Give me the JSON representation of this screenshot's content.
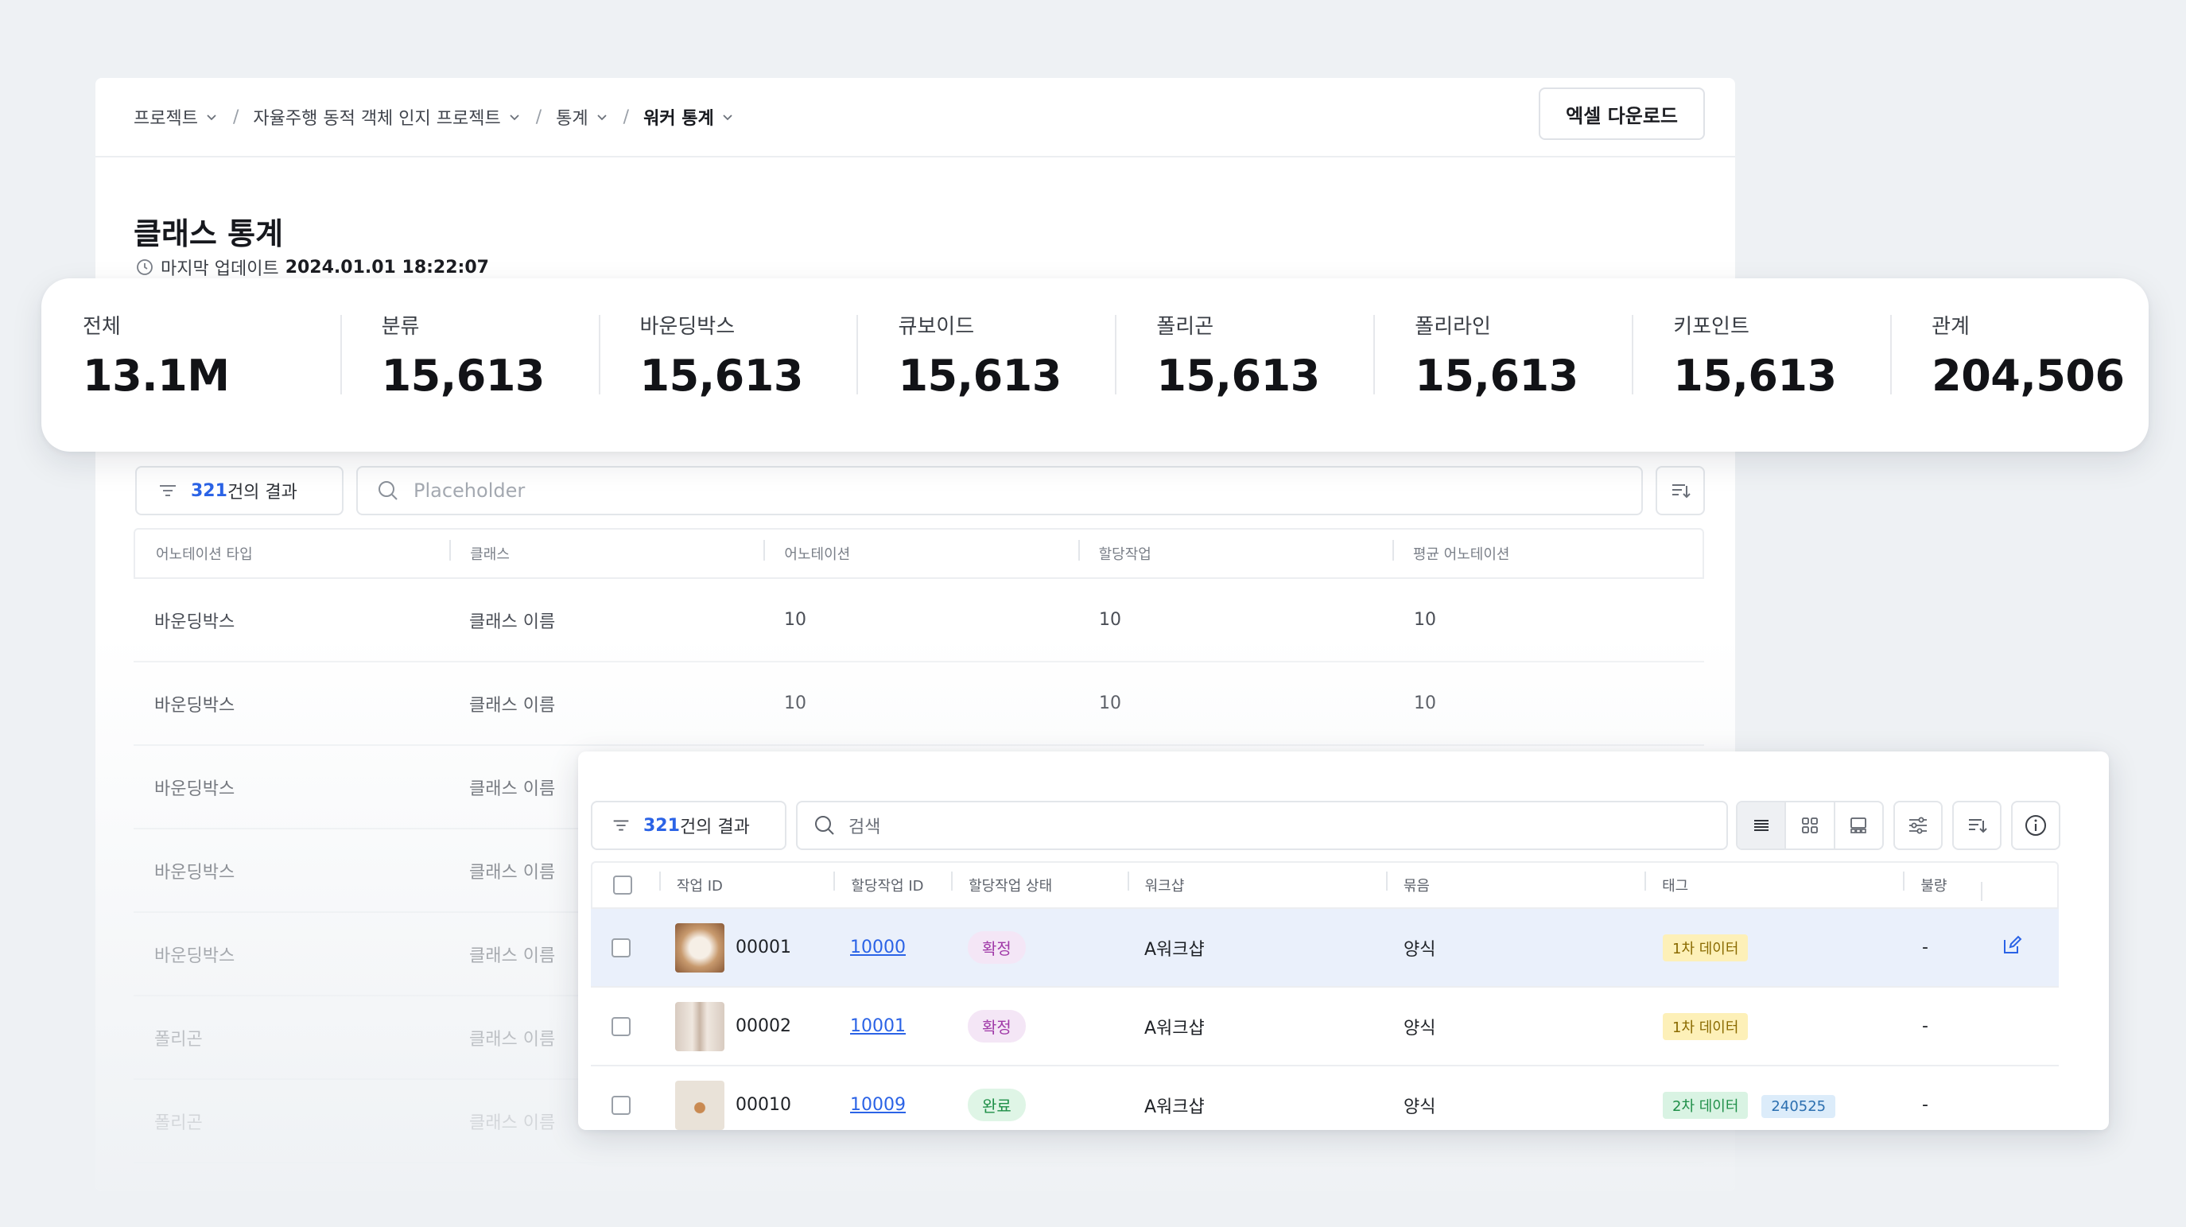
{
  "breadcrumb": [
    "프로젝트",
    "자율주행 동적 객체 인지 프로젝트",
    "통계",
    "워커 통계"
  ],
  "header": {
    "excel_download": "엑셀 다운로드"
  },
  "page": {
    "title": "클래스 통계",
    "last_update_label": "마지막 업데이트",
    "last_update_value": "2024.01.01 18:22:07"
  },
  "stats": [
    {
      "label": "전체",
      "value": "13.1M"
    },
    {
      "label": "분류",
      "value": "15,613"
    },
    {
      "label": "바운딩박스",
      "value": "15,613"
    },
    {
      "label": "큐보이드",
      "value": "15,613"
    },
    {
      "label": "폴리곤",
      "value": "15,613"
    },
    {
      "label": "폴리라인",
      "value": "15,613"
    },
    {
      "label": "키포인트",
      "value": "15,613"
    },
    {
      "label": "관계",
      "value": "204,506"
    }
  ],
  "class_table": {
    "result_count": "321",
    "result_suffix": "건의 결과",
    "search_placeholder": "Placeholder",
    "columns": [
      "어노테이션 타입",
      "클래스",
      "어노테이션",
      "할당작업",
      "평균 어노테이션"
    ],
    "rows": [
      [
        "바운딩박스",
        "클래스 이름",
        "10",
        "10",
        "10"
      ],
      [
        "바운딩박스",
        "클래스 이름",
        "10",
        "10",
        "10"
      ],
      [
        "바운딩박스",
        "클래스 이름",
        "",
        "",
        ""
      ],
      [
        "바운딩박스",
        "클래스 이름",
        "",
        "",
        ""
      ],
      [
        "바운딩박스",
        "클래스 이름",
        "",
        "",
        ""
      ],
      [
        "폴리곤",
        "클래스 이름",
        "",
        "",
        ""
      ],
      [
        "폴리곤",
        "클래스 이름",
        "",
        "",
        ""
      ]
    ]
  },
  "task_table": {
    "result_count": "321",
    "result_suffix": "건의 결과",
    "search_placeholder": "검색",
    "columns": [
      "작업 ID",
      "할당작업 ID",
      "할당작업 상태",
      "워크샵",
      "묶음",
      "태그",
      "불량"
    ],
    "rows": [
      {
        "task_id": "00001",
        "assign_id": "10000",
        "status": "확정",
        "workshop": "A워크샵",
        "bundle": "양식",
        "tags": [
          "1차 데이터"
        ],
        "defect": "-"
      },
      {
        "task_id": "00002",
        "assign_id": "10001",
        "status": "확정",
        "workshop": "A워크샵",
        "bundle": "양식",
        "tags": [
          "1차 데이터"
        ],
        "defect": "-"
      },
      {
        "task_id": "00010",
        "assign_id": "10009",
        "status": "완료",
        "workshop": "A워크샵",
        "bundle": "양식",
        "tags": [
          "2차 데이터",
          "240525"
        ],
        "defect": "-"
      }
    ]
  },
  "colors": {
    "accent": "#2b63e6",
    "selected_row": "#eaf0fb",
    "background": "#eef1f4"
  },
  "icons": [
    "chevron-down-icon",
    "clock-icon",
    "filter-icon",
    "search-icon",
    "sort-icon",
    "list-view-icon",
    "grid-view-icon",
    "gallery-view-icon",
    "settings-sliders-icon",
    "info-icon",
    "edit-icon"
  ]
}
